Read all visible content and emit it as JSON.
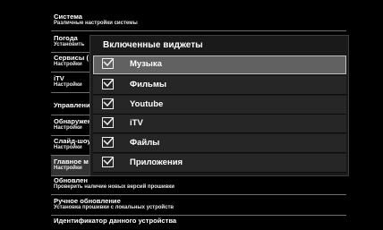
{
  "settings_list": [
    {
      "title": "Система",
      "description": "Различные настройки системы"
    },
    {
      "title": "Погода",
      "description": "Установить"
    },
    {
      "title": "Сервисы (",
      "description": "Настройки"
    },
    {
      "title": "iTV",
      "description": "Настройки"
    },
    {
      "title": "Управлени",
      "description": ""
    },
    {
      "title": "Обнаружен",
      "description": "Настройки"
    },
    {
      "title": "Слайд-шоу",
      "description": "Настройки"
    },
    {
      "title": "Главное м",
      "description": "Настройки"
    },
    {
      "title": "Обновлен",
      "description": "Проверить наличие новых версий прошивки"
    },
    {
      "title": "Ручное обновление",
      "description": "Установка прошивки с локальных устройств"
    },
    {
      "title": "Идентификатор данного устройства",
      "description": ""
    }
  ],
  "dialog": {
    "title": "Включенные виджеты",
    "options": [
      {
        "label": "Музыка",
        "checked": true,
        "selected": true
      },
      {
        "label": "Фильмы",
        "checked": true,
        "selected": false
      },
      {
        "label": "Youtube",
        "checked": true,
        "selected": false
      },
      {
        "label": "iTV",
        "checked": true,
        "selected": false
      },
      {
        "label": "Файлы",
        "checked": true,
        "selected": false
      },
      {
        "label": "Приложения",
        "checked": true,
        "selected": false
      }
    ]
  },
  "colors": {
    "background": "#000000",
    "dialog_background": "#1a1a1a",
    "option_background": "#262626",
    "option_selected": "#616161",
    "text": "#ffffff"
  }
}
